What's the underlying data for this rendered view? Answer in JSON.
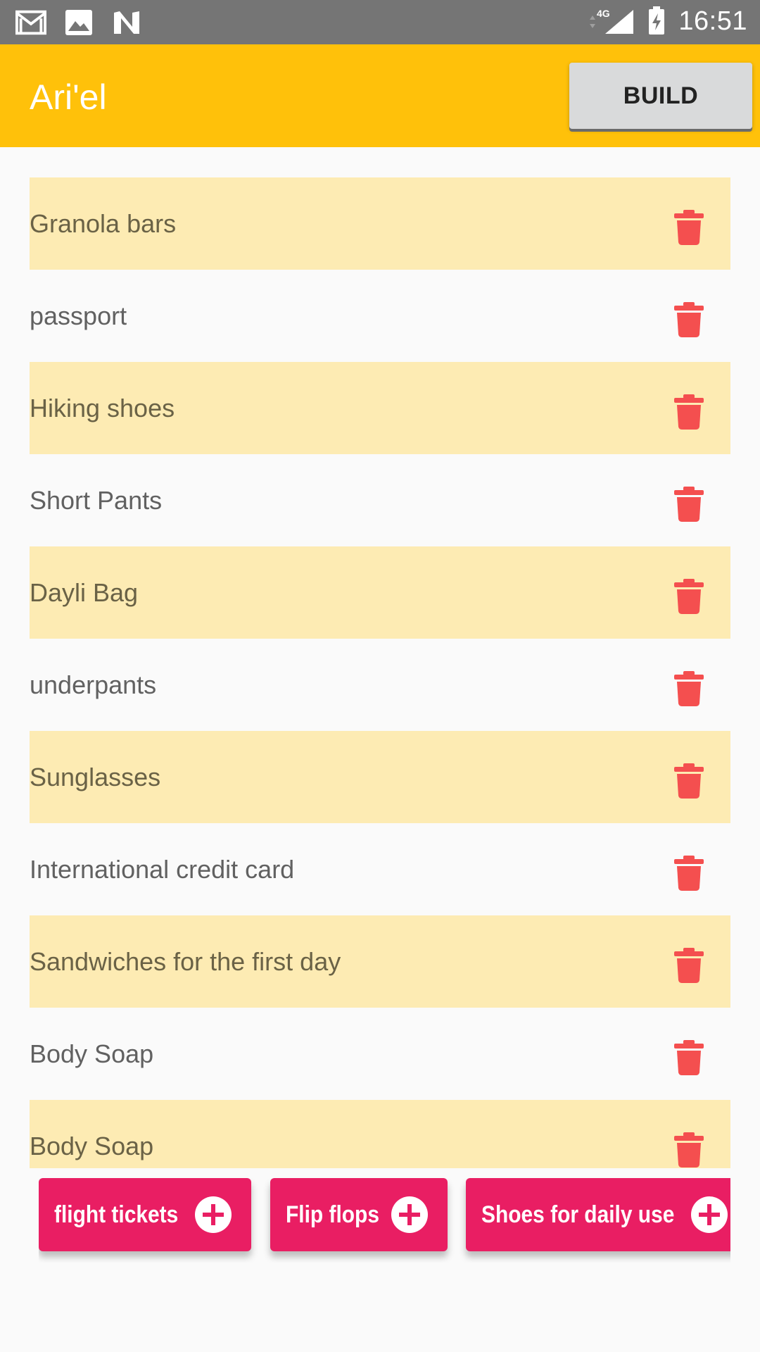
{
  "status_bar": {
    "time": "16:51",
    "network": "4G",
    "icons": [
      "gmail-icon",
      "image-icon",
      "n-notification-icon",
      "signal-icon",
      "battery-charging-icon"
    ]
  },
  "app_bar": {
    "title": "Ari'el",
    "build_label": "BUILD",
    "color": "#ffc10a"
  },
  "list": {
    "items": [
      {
        "label": "Granola bars"
      },
      {
        "label": "passport"
      },
      {
        "label": "Hiking shoes"
      },
      {
        "label": "Short Pants"
      },
      {
        "label": "Dayli Bag"
      },
      {
        "label": "underpants"
      },
      {
        "label": "Sunglasses"
      },
      {
        "label": "International credit card"
      },
      {
        "label": "Sandwiches for the first day"
      },
      {
        "label": "Body Soap"
      },
      {
        "label": "Body Soap"
      }
    ],
    "alt_row_color": "#fdebb3",
    "delete_icon": "trash-icon",
    "delete_color": "#f44f4f"
  },
  "suggestions": {
    "chips": [
      {
        "label": "flight tickets"
      },
      {
        "label": "Flip flops"
      },
      {
        "label": "Shoes for daily use"
      }
    ],
    "chip_color": "#e91e63",
    "add_icon": "plus-circle-icon"
  }
}
